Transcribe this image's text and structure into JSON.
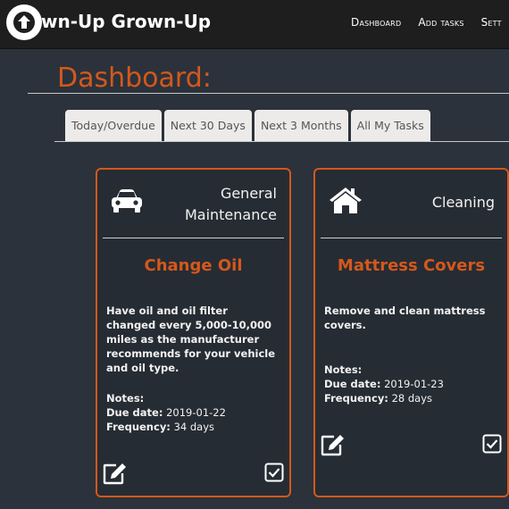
{
  "navbar": {
    "brand": "wn-Up Grown-Up",
    "links": [
      "Dashboard",
      "Add tasks",
      "Sett"
    ]
  },
  "page": {
    "title": "Dashboard:"
  },
  "tabs": [
    "Today/Overdue",
    "Next 30 Days",
    "Next 3 Months",
    "All My Tasks"
  ],
  "cards": [
    {
      "category_line1": "General",
      "category_line2": "Maintenance",
      "icon": "car-icon",
      "title": "Change Oil",
      "description": "Have oil and oil filter changed every 5,000-10,000 miles as the manufacturer recommends for your vehicle and oil type.",
      "notes_label": "Notes:",
      "due_label": "Due date:",
      "due_value": "2019-01-22",
      "freq_label": "Frequency:",
      "freq_value": "34 days"
    },
    {
      "category_line1": "Cleaning",
      "category_line2": "",
      "icon": "house-icon",
      "title": "Mattress Covers",
      "description": "Remove and clean mattress covers.",
      "notes_label": "Notes:",
      "due_label": "Due date:",
      "due_value": "2019-01-23",
      "freq_label": "Frequency:",
      "freq_value": "28 days"
    }
  ],
  "colors": {
    "accent": "#d4581c",
    "background": "#2b323b",
    "navbar": "#1e1e1e"
  }
}
